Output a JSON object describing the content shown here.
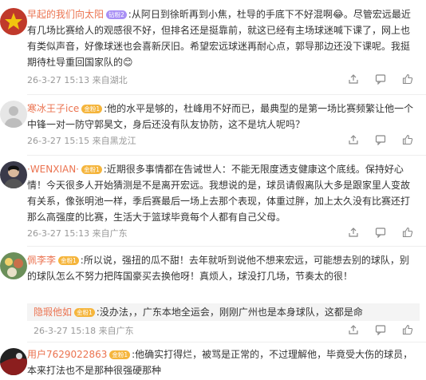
{
  "comments": [
    {
      "user": "早起的我们向太阳",
      "badge": "钻粉2",
      "text": ":从阿日到徐昕再到小焦，杜导的手底下不好混啊😂。尽管宏远最近有几场比赛给人的观感很不好，但排名还是挺靠前，就这已经有主场球迷喊下课了，网上也有类似声音，好像球迷也会喜新厌旧。希望宏远球迷再耐心点，郭导那边还没下课呢。我挺期待杜导重回国家队的😊",
      "time": "26-3-27 15:13",
      "location": "来自湖北"
    },
    {
      "user": "寒冰王子ice",
      "badge": "金粉1",
      "text": ":他的水平是够的，杜峰用不好而已，最典型的是第一场比赛频繁让他一个中锋一对一防守郭昊文，身后还没有队友协防，这不是坑人呢吗？",
      "time": "26-3-27 15:15",
      "location": "来自黑龙江"
    },
    {
      "user": "·WENXIAN·",
      "badge": "金粉1",
      "text": ":近期很多事情都在告诫世人：不能无限度透支健康这个底线。保持好心情！今天很多人开始猜测是不是离开宏远。我想说的是，球员请假离队大多是跟家里人变故有关系，像张明池一样，季后赛最后一场上去那个表现，体重过胖，加上太久没有比赛还打那么高强度的比赛，生活大于篮球毕竟每个人都有自己父母。",
      "time": "26-3-27 15:13",
      "location": "来自广东"
    },
    {
      "user": "佩李李",
      "badge": "金粉1",
      "text": ":所以说，强扭的瓜不甜！去年就听到说他不想来宏远，可能想去别的球队，别的球队怎么不努力把阵国豪买去换他呀！真烦人，球没打几场，节奏太的很！",
      "time": "26-3-27 15:14",
      "location": "来自广东",
      "reply": {
        "user": "隐瑕他如",
        "badge": "金粉1",
        "text": ":没办法，，广东本地全运会，刚刚广州也是本身球队，这都是命",
        "time": "26-3-27 15:18",
        "location": "来自广东"
      }
    },
    {
      "user": "用户7629022863",
      "badge": "金粉1",
      "text": ":他确实打得烂，被骂是正常的，不过理解他，毕竟受大伤的球员，本来打法也不是那种很强硬那种"
    }
  ],
  "colors": {
    "name": "#eb7350",
    "meta": "#999999",
    "badge_purple": "#a990f5",
    "badge_gold": "#f5b53c"
  },
  "icons": [
    "share-icon",
    "comment-icon",
    "like-icon"
  ]
}
